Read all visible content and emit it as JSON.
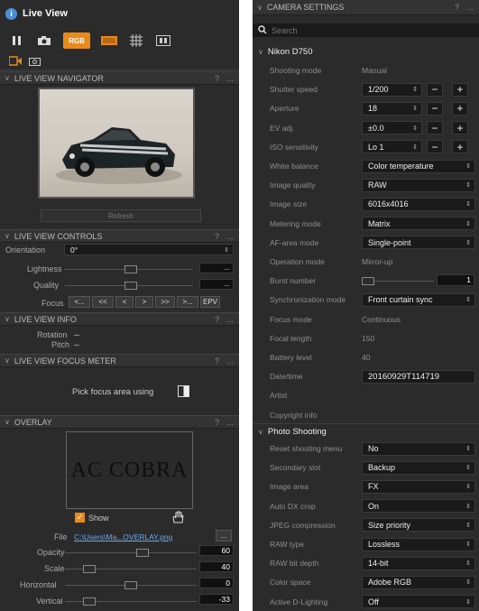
{
  "left": {
    "title": "Live View",
    "toolbar": {
      "rgb_label": "RGB"
    },
    "navigator": {
      "header": "LIVE VIEW NAVIGATOR",
      "refresh": "Refresh"
    },
    "controls": {
      "header": "LIVE VIEW CONTROLS",
      "orientation_label": "Orientation",
      "orientation_value": "0°",
      "lightness_label": "Lightness",
      "lightness_value": "...",
      "quality_label": "Quality",
      "quality_value": "...",
      "focus_label": "Focus",
      "focus_buttons": [
        "<...",
        "<<",
        "<",
        ">",
        ">>",
        ">...",
        "EPV"
      ]
    },
    "info": {
      "header": "LIVE VIEW INFO",
      "rotation_label": "Rotation",
      "rotation_value": "--",
      "pitch_label": "Pitch",
      "pitch_value": "--"
    },
    "focus_meter": {
      "header": "LIVE VIEW FOCUS METER",
      "pick_label": "Pick focus area using"
    },
    "overlay": {
      "header": "OVERLAY",
      "preview_text": "AC COBRA",
      "show_label": "Show",
      "file_label": "File",
      "file_value": "C:\\Users\\Ma...OVERLAY.png",
      "browse": "...",
      "opacity_label": "Opacity",
      "opacity_value": "60",
      "opacity_level": 0.6,
      "scale_label": "Scale",
      "scale_value": "40",
      "scale_level": 0.15,
      "horizontal_label": "Horizontal",
      "horizontal_value": "0",
      "horizontal_level": 0.5,
      "vertical_label": "Vertical",
      "vertical_value": "-33",
      "vertical_level": 0.15
    },
    "help": "?",
    "more": "..."
  },
  "right": {
    "header": "CAMERA SETTINGS",
    "search_placeholder": "Search",
    "camera": "Nikon D750",
    "rows": [
      {
        "k": "Shooting mode",
        "v": "Manual",
        "type": "text"
      },
      {
        "k": "Shutter speed",
        "v": "1/200",
        "type": "spin"
      },
      {
        "k": "Aperture",
        "v": "18",
        "type": "spin"
      },
      {
        "k": "EV adj.",
        "v": "±0.0",
        "type": "spin"
      },
      {
        "k": "ISO sensitivity",
        "v": "Lo 1",
        "type": "spin"
      },
      {
        "k": "White balance",
        "v": "Color temperature",
        "type": "sel"
      },
      {
        "k": "Image quality",
        "v": "RAW",
        "type": "sel"
      },
      {
        "k": "Image size",
        "v": "6016x4016",
        "type": "sel"
      },
      {
        "k": "Metering mode",
        "v": "Matrix",
        "type": "sel"
      },
      {
        "k": "AF-area mode",
        "v": "Single-point",
        "type": "sel"
      },
      {
        "k": "Operation mode",
        "v": "Mirror-up",
        "type": "text"
      },
      {
        "k": "Burst number",
        "v": "1",
        "type": "slider"
      },
      {
        "k": "Synchronization mode",
        "v": "Front curtain sync",
        "type": "sel"
      },
      {
        "k": "Focus mode",
        "v": "Continuous",
        "type": "text"
      },
      {
        "k": "Focal length",
        "v": "150",
        "type": "text"
      },
      {
        "k": "Battery level",
        "v": "40",
        "type": "text"
      },
      {
        "k": "Date/time",
        "v": "20160929T114719",
        "type": "box"
      },
      {
        "k": "Artist",
        "v": "",
        "type": "text"
      },
      {
        "k": "Copyright info",
        "v": "",
        "type": "text"
      }
    ],
    "group2": "Photo Shooting",
    "rows2": [
      {
        "k": "Reset shooting menu",
        "v": "No"
      },
      {
        "k": "Secondary slot",
        "v": "Backup"
      },
      {
        "k": "Image area",
        "v": "FX"
      },
      {
        "k": "Auto DX crop",
        "v": "On"
      },
      {
        "k": "JPEG compression",
        "v": "Size priority"
      },
      {
        "k": "RAW type",
        "v": "Lossless"
      },
      {
        "k": "RAW bit depth",
        "v": "14-bit"
      },
      {
        "k": "Color space",
        "v": "Adobe RGB"
      },
      {
        "k": "Active D-Lighting",
        "v": "Off"
      }
    ],
    "help": "?",
    "more": "..."
  }
}
